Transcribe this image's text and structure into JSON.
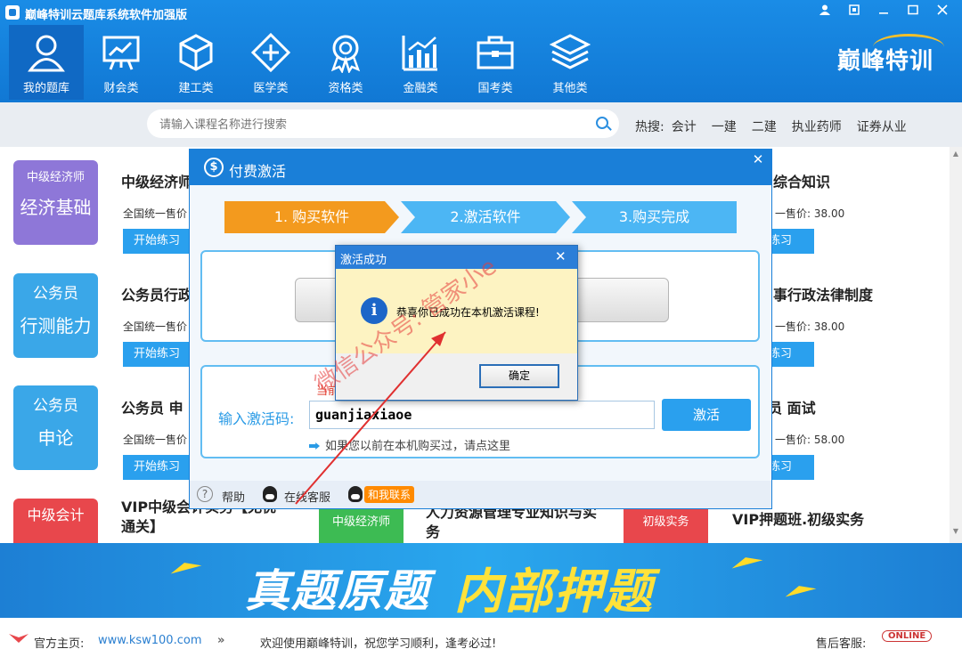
{
  "window": {
    "title": "巅峰特训云题库系统软件加强版"
  },
  "nav": {
    "items": [
      {
        "label": "我的题库",
        "icon": "user-icon"
      },
      {
        "label": "财会类",
        "icon": "chart-board-icon"
      },
      {
        "label": "建工类",
        "icon": "cube-icon"
      },
      {
        "label": "医学类",
        "icon": "medical-cross-icon"
      },
      {
        "label": "资格类",
        "icon": "award-icon"
      },
      {
        "label": "金融类",
        "icon": "bar-chart-icon"
      },
      {
        "label": "国考类",
        "icon": "briefcase-icon"
      },
      {
        "label": "其他类",
        "icon": "layers-icon"
      }
    ],
    "brand": "巅峰特训"
  },
  "search": {
    "placeholder": "请输入课程名称进行搜索"
  },
  "hot": {
    "label": "热搜:",
    "items": [
      "会计",
      "一建",
      "二建",
      "执业药师",
      "证券从业"
    ]
  },
  "cards": {
    "c1": {
      "badge_top": "中级经济师",
      "badge_main": "经济基础",
      "title": "中级经济师",
      "price": "全国统一售价",
      "btn": "开始练习"
    },
    "c2": {
      "badge_top": "公务员",
      "badge_main": "行测能力",
      "title": "公务员行政",
      "price": "全国统一售价",
      "btn": "开始练习"
    },
    "c3": {
      "badge_top": "公务员",
      "badge_main": "申论",
      "title": "公务员  申",
      "price": "全国统一售价",
      "btn": "开始练习"
    },
    "c4": {
      "badge_top": "中级会计",
      "title": "VIP中级会计实务【无忧通关】"
    },
    "c5": {
      "badge_top": "中级经济师",
      "title": "人力资源管理专业知识与实务"
    },
    "c6": {
      "badge_top": "初级实务",
      "title": "VIP押题班.初级实务"
    },
    "r1": {
      "title": "综合知识",
      "price": "一售价: 38.00",
      "btn": "练习"
    },
    "r2": {
      "title": "事行政法律制度",
      "price": "一售价: 38.00",
      "btn": "练习"
    },
    "r3": {
      "title": "员  面试",
      "price": "一售价: 58.00",
      "btn": "练习"
    }
  },
  "banner": {
    "text_white": "真题原题",
    "text_yellow": "内部押题"
  },
  "footer": {
    "home_label": "官方主页:",
    "home_url": "www.ksw100.com",
    "welcome": "欢迎使用巅峰特训，祝您学习顺利，逢考必过!",
    "service_label": "售后客服:",
    "online": "ONLINE"
  },
  "pay_dialog": {
    "title": "付费激活",
    "steps": [
      "1. 购买软件",
      "2.激活软件",
      "3.购买完成"
    ],
    "current_tip": "当前",
    "code_label": "输入激活码:",
    "code_value": "guanjiaxiaoe",
    "activate_btn": "激活",
    "hint": "如果您以前在本机购买过，请点这里",
    "help": "帮助",
    "service": "在线客服",
    "contact": "和我联系"
  },
  "success_dialog": {
    "title": "激活成功",
    "message": "恭喜你已成功在本机激活课程!",
    "ok": "确定"
  },
  "watermark": {
    "line1": "微信公众号: 管家小e"
  },
  "colors": {
    "primary": "#1a7fd8",
    "orange": "#f39a1e",
    "button_blue": "#2aa0ee"
  }
}
